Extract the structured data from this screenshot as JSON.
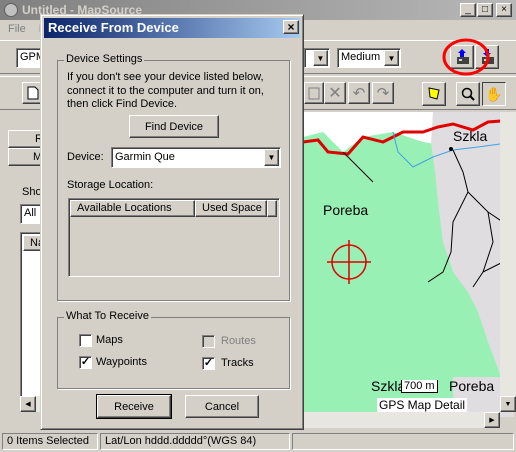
{
  "main_window": {
    "title": "Untitled - MapSource",
    "menu": [
      "File",
      "E"
    ],
    "controls": {
      "minimize": "_",
      "maximize": "□",
      "close": "×"
    }
  },
  "toolbar": {
    "product_select": "GPM",
    "detail_select": "Medium",
    "receive_from_device_icon": "receive-from-device-icon",
    "send_to_device_icon": "send-to-device-icon"
  },
  "left_panel": {
    "tab_1": "R",
    "tab_2": "M",
    "show_label": "Sho",
    "show_select": "All C",
    "list_header": "Na"
  },
  "map": {
    "labels": {
      "szkla_top": "Szkla",
      "poreba_left": "Poreba",
      "szkla_bottom": "Szkla",
      "poreba_bottom": "Poreba"
    },
    "scale": "700 m",
    "detail": "GPS Map Detail"
  },
  "dialog": {
    "title": "Receive From Device",
    "close": "×",
    "device_settings": {
      "legend": "Device Settings",
      "help_line_1": "If you don't see your device listed below,",
      "help_line_2": "connect it to the computer and turn it on,",
      "help_line_3": "then click Find Device.",
      "find_device_button": "Find Device",
      "device_label": "Device:",
      "device_value": "Garmin Que",
      "storage_label": "Storage Location:",
      "columns": [
        "Available Locations",
        "Used Space"
      ]
    },
    "what_to_receive": {
      "legend": "What To Receive",
      "maps": {
        "label": "Maps",
        "checked": false,
        "enabled": true
      },
      "routes": {
        "label": "Routes",
        "checked": false,
        "enabled": false
      },
      "waypoints": {
        "label": "Waypoints",
        "checked": true,
        "enabled": true
      },
      "tracks": {
        "label": "Tracks",
        "checked": true,
        "enabled": true
      }
    },
    "receive_button": "Receive",
    "cancel_button": "Cancel"
  },
  "status_bar": {
    "items_selected": "0 Items Selected",
    "coord_format": "Lat/Lon hddd.ddddd°(WGS 84)"
  },
  "colors": {
    "dialog_title_start": "#0a246a",
    "dialog_title_end": "#a6caf0",
    "map_green": "#98f0b4",
    "map_gray": "#e0dde0",
    "road_red": "#e00000",
    "highlight_circle": "#ff0000"
  }
}
